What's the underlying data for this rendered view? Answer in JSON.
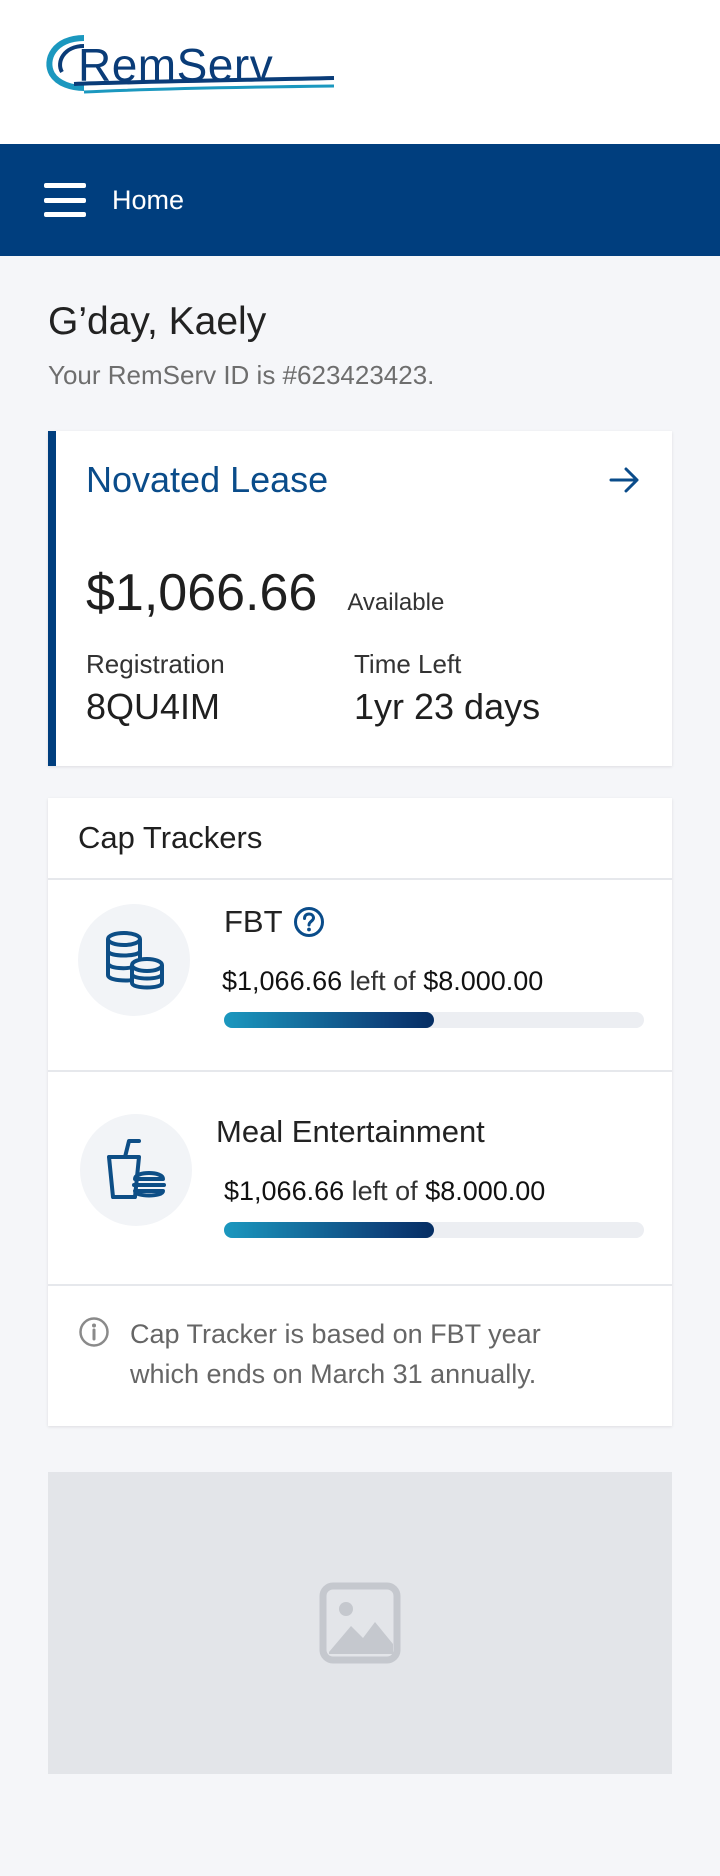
{
  "brand": {
    "name": "RemServ",
    "primary_color": "#003e7e",
    "accent_color": "#1b98bf"
  },
  "nav": {
    "title": "Home",
    "menu_icon": "hamburger-menu-icon"
  },
  "greeting": {
    "title": "G’day, Kaely",
    "subtitle": "Your RemServ ID is #623423423."
  },
  "lease": {
    "title": "Novated Lease",
    "amount": "$1,066.66",
    "amount_label": "Available",
    "registration_label": "Registration",
    "registration_value": "8QU4IM",
    "time_left_label": "Time Left",
    "time_left_value": "1yr 23 days",
    "arrow_icon": "arrow-right-icon"
  },
  "caps": {
    "title": "Cap Trackers",
    "trackers": [
      {
        "name": "FBT",
        "icon": "coins-stack-icon",
        "left": "$1,066.66",
        "of_text": "left of",
        "total": "$8.000.00",
        "progress": 0.5
      },
      {
        "name": "Meal Entertainment",
        "icon": "meal-icon",
        "left": "$1,066.66",
        "of_text": "left of",
        "total": "$8.000.00",
        "progress": 0.5
      }
    ],
    "info": "Cap Tracker is based on FBT year which ends on March 31 annually."
  },
  "image_placeholder_icon": "image-icon"
}
